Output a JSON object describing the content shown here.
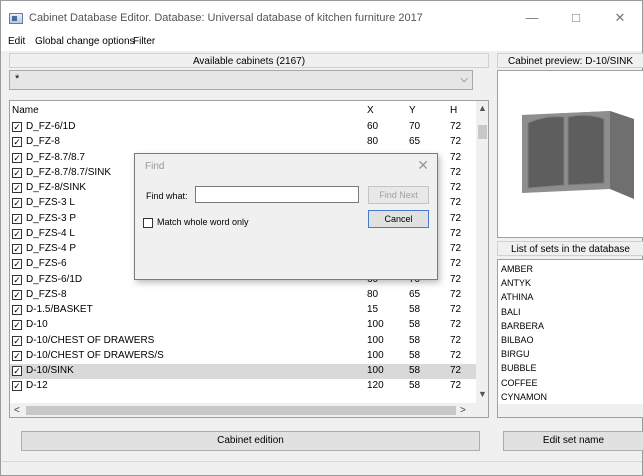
{
  "window": {
    "title": "Cabinet Database Editor. Database: Universal database of kitchen furniture 2017",
    "controls": {
      "minimize": "—",
      "maximize": "□",
      "close": "✕"
    }
  },
  "menu": [
    "Edit",
    "Global change options",
    "Filter"
  ],
  "cabinets": {
    "header": "Available cabinets (2167)",
    "filter_value": "*",
    "filter_arrow": "⌵",
    "columns": {
      "name": "Name",
      "x": "X",
      "y": "Y",
      "h": "H"
    },
    "rows": [
      {
        "name": "D_FZ-6/1D",
        "x": "60",
        "y": "70",
        "h": "72",
        "selected": false
      },
      {
        "name": "D_FZ-8",
        "x": "80",
        "y": "65",
        "h": "72",
        "selected": false
      },
      {
        "name": "D_FZ-8.7/8.7",
        "x": "",
        "y": "",
        "h": "72",
        "selected": false
      },
      {
        "name": "D_FZ-8.7/8.7/SINK",
        "x": "",
        "y": "",
        "h": "72",
        "selected": false
      },
      {
        "name": "D_FZ-8/SINK",
        "x": "",
        "y": "",
        "h": "72",
        "selected": false
      },
      {
        "name": "D_FZS-3 L",
        "x": "",
        "y": "",
        "h": "72",
        "selected": false
      },
      {
        "name": "D_FZS-3 P",
        "x": "",
        "y": "",
        "h": "72",
        "selected": false
      },
      {
        "name": "D_FZS-4 L",
        "x": "",
        "y": "",
        "h": "72",
        "selected": false
      },
      {
        "name": "D_FZS-4 P",
        "x": "",
        "y": "",
        "h": "72",
        "selected": false
      },
      {
        "name": "D_FZS-6",
        "x": "",
        "y": "",
        "h": "72",
        "selected": false
      },
      {
        "name": "D_FZS-6/1D",
        "x": "60",
        "y": "70",
        "h": "72",
        "selected": false
      },
      {
        "name": "D_FZS-8",
        "x": "80",
        "y": "65",
        "h": "72",
        "selected": false
      },
      {
        "name": "D-1.5/BASKET",
        "x": "15",
        "y": "58",
        "h": "72",
        "selected": false
      },
      {
        "name": "D-10",
        "x": "100",
        "y": "58",
        "h": "72",
        "selected": false
      },
      {
        "name": "D-10/CHEST OF DRAWERS",
        "x": "100",
        "y": "58",
        "h": "72",
        "selected": false
      },
      {
        "name": "D-10/CHEST OF DRAWERS/S",
        "x": "100",
        "y": "58",
        "h": "72",
        "selected": false
      },
      {
        "name": "D-10/SINK",
        "x": "100",
        "y": "58",
        "h": "72",
        "selected": true
      },
      {
        "name": "D-12",
        "x": "120",
        "y": "58",
        "h": "72",
        "selected": false
      }
    ],
    "check_mark": "✓",
    "scroll": {
      "up": "▲",
      "down": "▼",
      "left": "<",
      "right": ">"
    },
    "edit_button": "Cabinet edition"
  },
  "preview": {
    "header": "Cabinet preview: D-10/SINK",
    "colors": {
      "body": "#8e8e8e",
      "door": "#5e5e5e",
      "top": "#a9a9a9"
    }
  },
  "sets": {
    "header": "List of sets in the database",
    "items": [
      "AMBER",
      "ANTYK",
      "ATHINA",
      "BALI",
      "BARBERA",
      "BILBAO",
      "BIRGU",
      "BUBBLE",
      "COFFEE",
      "CYNAMON"
    ],
    "edit_button": "Edit set name"
  },
  "find_dialog": {
    "title": "Find",
    "close": "✕",
    "find_label": "Find what:",
    "find_value": "",
    "find_next": "Find Next",
    "cancel": "Cancel",
    "match_whole_word": "Match whole word only",
    "match_checked": false
  }
}
